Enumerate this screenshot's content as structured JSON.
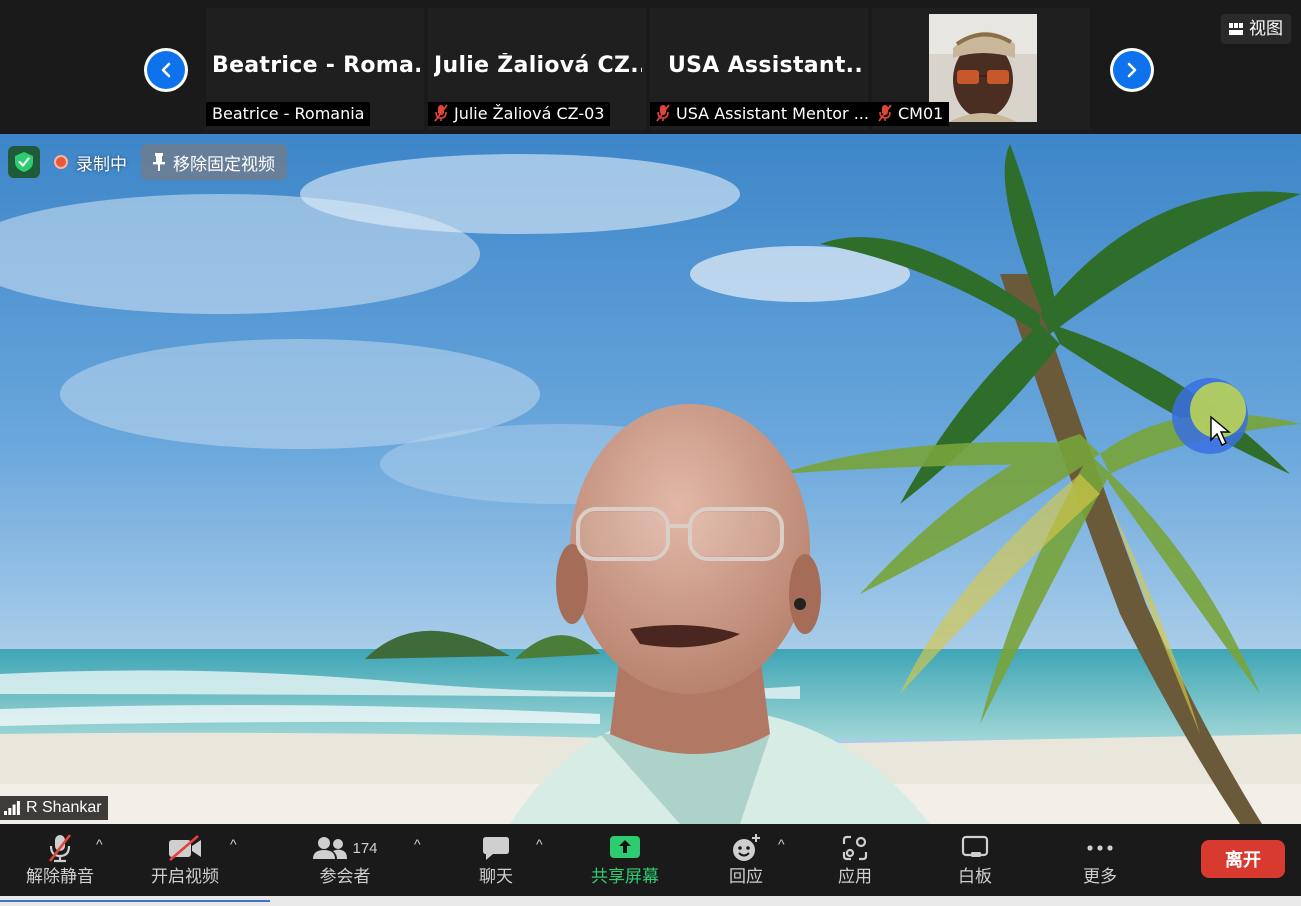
{
  "top_strip": {
    "tiles": [
      {
        "display_name": "Beatrice - Roma...",
        "label": "Beatrice - Romania",
        "muted": false
      },
      {
        "display_name": "Julie Žaliová CZ...",
        "label": "Julie Žaliová CZ-03",
        "muted": true
      },
      {
        "display_name": "USA Assistant...",
        "label": "USA Assistant Mentor ...",
        "muted": true
      },
      {
        "display_name": "",
        "label": "CM01",
        "muted": true
      }
    ],
    "view_label": "视图"
  },
  "main_video": {
    "recording_label": "录制中",
    "unpin_label": "移除固定视频",
    "speaker_name": "R Shankar"
  },
  "toolbar": {
    "unmute_label": "解除静音",
    "start_video_label": "开启视频",
    "participants_label": "参会者",
    "participants_count": "174",
    "chat_label": "聊天",
    "share_screen_label": "共享屏幕",
    "reactions_label": "回应",
    "apps_label": "应用",
    "whiteboard_label": "白板",
    "more_label": "更多",
    "leave_label": "离开"
  },
  "colors": {
    "share_green": "#2ecc71",
    "leave_red": "#d93a2f",
    "nav_blue": "#0e72ed",
    "mic_off_red": "#e0443a"
  }
}
